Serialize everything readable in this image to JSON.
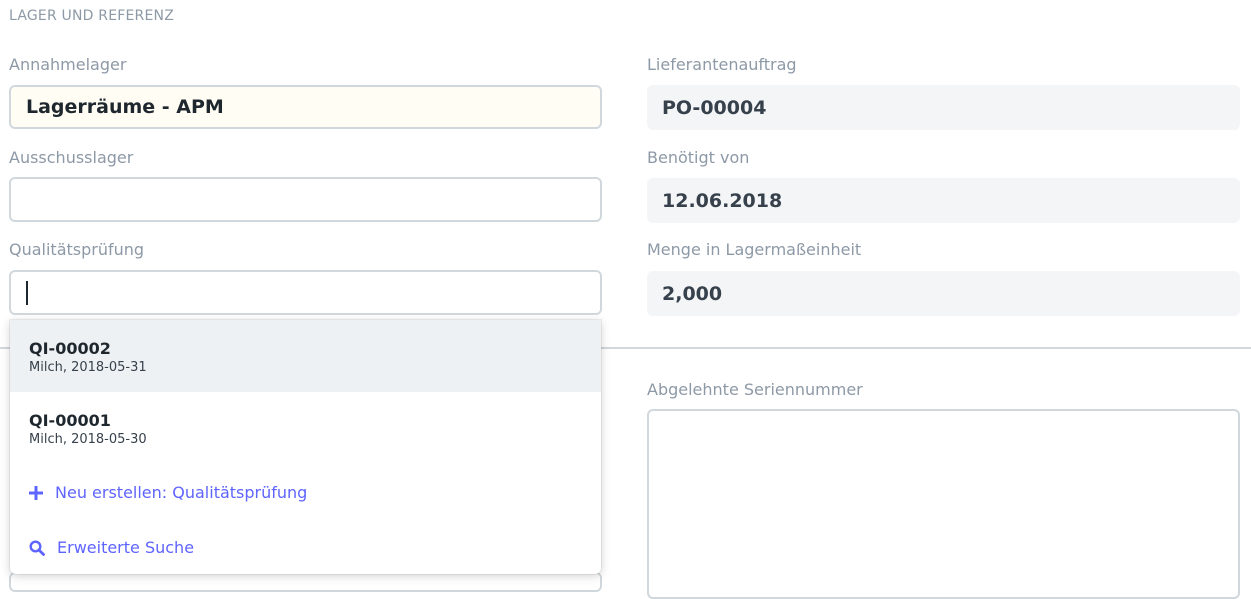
{
  "section": {
    "title": "LAGER UND REFERENZ"
  },
  "left": {
    "annahmelager": {
      "label": "Annahmelager",
      "value": "Lagerräume - APM"
    },
    "ausschusslager": {
      "label": "Ausschusslager",
      "value": ""
    },
    "qualitaetspruefung": {
      "label": "Qualitätsprüfung",
      "value": ""
    }
  },
  "right": {
    "lieferantenauftrag": {
      "label": "Lieferantenauftrag",
      "value": "PO-00004"
    },
    "benoetigt_von": {
      "label": "Benötigt von",
      "value": "12.06.2018"
    },
    "menge": {
      "label": "Menge in Lagermaßeinheit",
      "value": "2,000"
    },
    "abgelehnte_seriennummer": {
      "label": "Abgelehnte Seriennummer",
      "value": ""
    }
  },
  "dropdown": {
    "items": [
      {
        "name": "QI-00002",
        "desc": "Milch, 2018-05-31"
      },
      {
        "name": "QI-00001",
        "desc": "Milch, 2018-05-30"
      }
    ],
    "create_label": "Neu erstellen: Qualitätsprüfung",
    "search_label": "Erweiterte Suche",
    "create_icon": "plus-icon",
    "search_icon": "search-icon",
    "accent_color": "#5e64ff"
  }
}
